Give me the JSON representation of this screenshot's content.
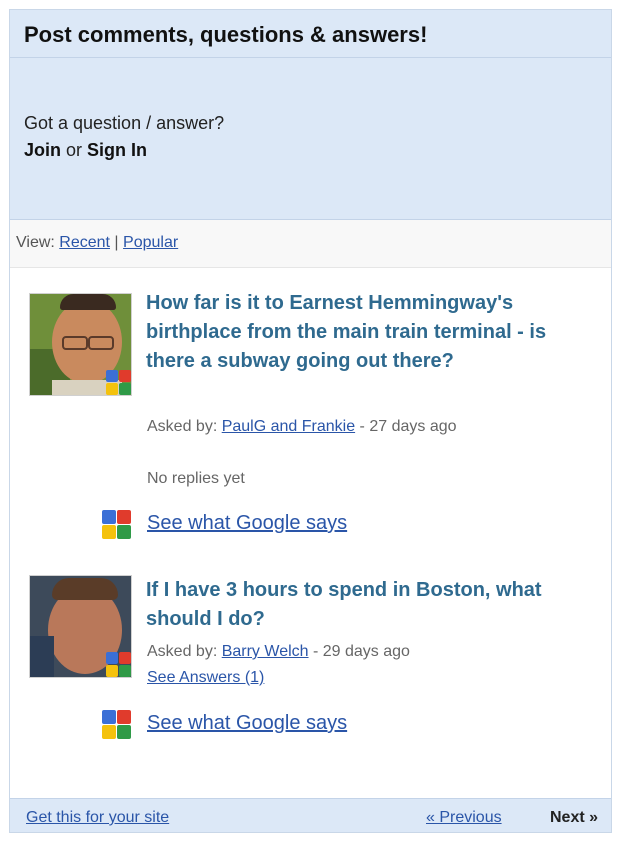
{
  "header": {
    "title": "Post comments, questions & answers!"
  },
  "join": {
    "prompt": "Got a question / answer?",
    "join_label": "Join",
    "or_text": " or ",
    "signin_label": "Sign In"
  },
  "view": {
    "label": "View: ",
    "recent": "Recent",
    "separator": " | ",
    "popular": "Popular"
  },
  "questions": [
    {
      "title": "How far is it to Earnest Hemmingway's birthplace from the main train terminal - is there a subway going out there?",
      "asked_by_label": "Asked by: ",
      "author": "PaulG and Frankie",
      "age": " - 27 days ago",
      "status": "No replies yet",
      "google_says": "See what Google says"
    },
    {
      "title": "If I have 3 hours to spend in Boston, what should I do?",
      "asked_by_label": "Asked by: ",
      "author": "Barry Welch",
      "age": " - 29 days ago",
      "answers_link": "See Answers (1)",
      "google_says": "See what Google says"
    }
  ],
  "footer": {
    "get_this": "Get this for your site",
    "previous": "« Previous",
    "next": "Next »"
  },
  "icons": [
    "google-badge-icon"
  ],
  "colors": {
    "panel_bg": "#dce8f7",
    "link": "#2a55a8",
    "question_title": "#2f6a8f"
  }
}
